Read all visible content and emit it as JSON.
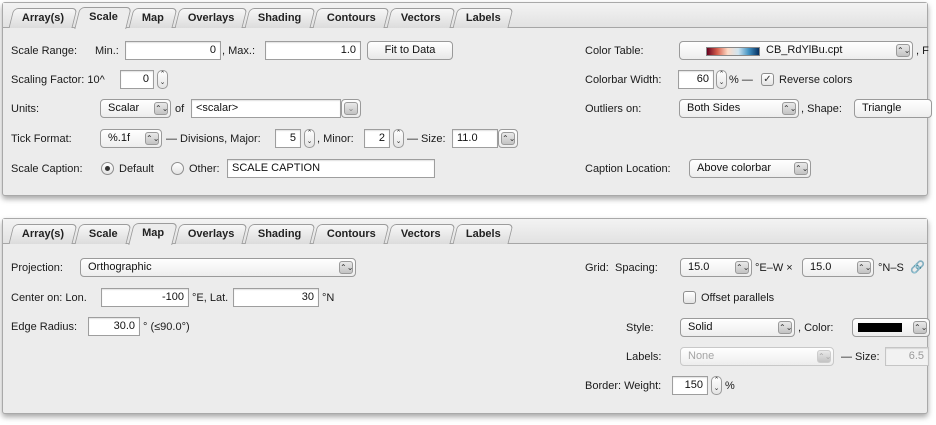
{
  "tabs": [
    "Array(s)",
    "Scale",
    "Map",
    "Overlays",
    "Shading",
    "Contours",
    "Vectors",
    "Labels"
  ],
  "scale_panel": {
    "active_tab": "Scale",
    "scale_range_label": "Scale Range:",
    "min_label": "Min.:",
    "min_value": "0",
    "max_label": ", Max.:",
    "max_value": "1.0",
    "fit_button": "Fit to Data",
    "scaling_factor_label": "Scaling Factor: 10^",
    "scaling_factor_value": "0",
    "units_label": "Units:",
    "units_value": "Scalar",
    "of_label": "of",
    "units_of_value": "<scalar>",
    "tick_format_label": "Tick Format:",
    "tick_format_value": "%.1f",
    "divisions_major_label": "— Divisions, Major:",
    "major_value": "5",
    "minor_label": ", Minor:",
    "minor_value": "2",
    "size_label": "— Size:",
    "size_value": "11.0",
    "caption_label": "Scale Caption:",
    "default_label": "Default",
    "other_label": "Other:",
    "caption_value": "SCALE CAPTION",
    "color_table_label": "Color Table:",
    "color_table_value": "CB_RdYlBu.cpt",
    "color_table_suffix": ", F",
    "colorbar_width_label": "Colorbar Width:",
    "colorbar_width_value": "60",
    "colorbar_width_unit": "% —",
    "reverse_colors_label": "Reverse colors",
    "outliers_label": "Outliers on:",
    "outliers_value": "Both Sides",
    "shape_label": ", Shape:",
    "shape_value": "Triangle",
    "caption_location_label": "Caption Location:",
    "caption_location_value": "Above colorbar"
  },
  "map_panel": {
    "active_tab": "Map",
    "projection_label": "Projection:",
    "projection_value": "Orthographic",
    "center_label": "Center on: Lon.",
    "lon_value": "-100",
    "lon_unit": "°E, Lat.",
    "lat_value": "30",
    "lat_unit": "°N",
    "edge_radius_label": "Edge Radius:",
    "edge_radius_value": "30.0",
    "edge_radius_note": "° (≤90.0°)",
    "grid_label": "Grid:",
    "spacing_label": "Spacing:",
    "spacing_ew_value": "15.0",
    "ew_label": "°E–W ×",
    "spacing_ns_value": "15.0",
    "ns_label": "°N–S",
    "offset_parallels_label": "Offset parallels",
    "style_label": "Style:",
    "style_value": "Solid",
    "color_label": ", Color:",
    "labels_label": "Labels:",
    "labels_value": "None",
    "label_size_label": "— Size:",
    "label_size_value": "6.5",
    "border_label": "Border: Weight:",
    "border_value": "150",
    "border_unit": "%"
  }
}
